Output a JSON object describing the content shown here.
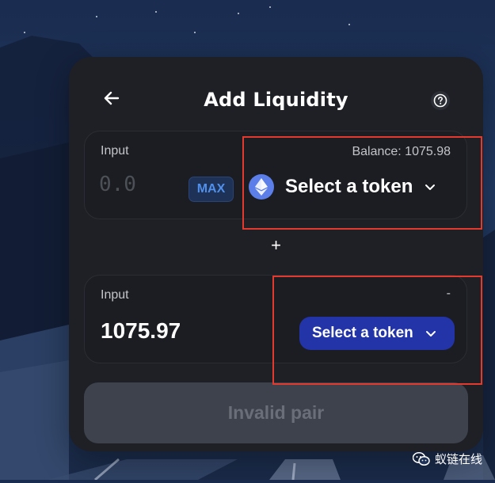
{
  "header": {
    "title": "Add Liquidity",
    "back_icon": "arrow-left-icon",
    "help_icon": "question-circle-icon"
  },
  "input_a": {
    "label": "Input",
    "balance_label": "Balance: 1075.98",
    "amount_placeholder": "0.0",
    "max_label": "MAX",
    "token_label": "Select a token",
    "token_icon": "ethereum-icon"
  },
  "separator": "+",
  "input_b": {
    "label": "Input",
    "balance_label": "-",
    "amount_value": "1075.97",
    "token_label": "Select a token"
  },
  "submit": {
    "label": "Invalid pair",
    "disabled": true
  },
  "watermark": {
    "text": "蚁链在线"
  },
  "colors": {
    "modal_bg": "#1f2026",
    "panel_border": "#2b2d34",
    "accent_blue": "#2234a8",
    "max_text": "#5090ea",
    "highlight_red": "#e23a2f",
    "disabled_button": "#3e424c"
  }
}
